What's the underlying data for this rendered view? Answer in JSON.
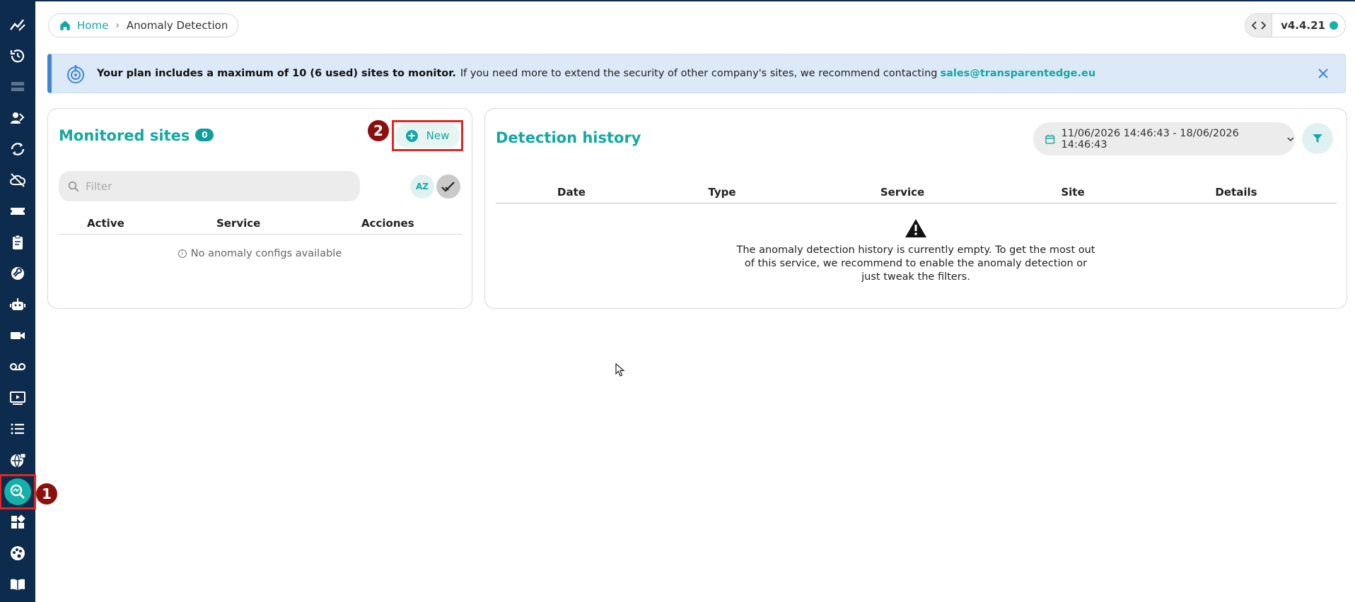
{
  "sidebar": {
    "icons": [
      "analytics-icon",
      "history-icon",
      "servers-icon",
      "users-icon",
      "sync-icon",
      "cloud-off-icon",
      "ticket-icon",
      "clipboard-icon",
      "wrench-icon",
      "robot-icon",
      "video-icon",
      "voicemail-icon",
      "player-icon",
      "list-icon",
      "globe-lock-icon",
      "anomaly-detection-icon",
      "dashboard-icon",
      "palette-icon",
      "book-icon"
    ],
    "active": "anomaly-detection-icon"
  },
  "steps": {
    "one": "1",
    "two": "2"
  },
  "breadcrumb": {
    "home": "Home",
    "separator": "›",
    "current": "Anomaly Detection"
  },
  "version": {
    "label": "v4.4.21"
  },
  "alert": {
    "bold": "Your plan includes a maximum of 10 (6 used) sites to monitor.",
    "text": "If you need more to extend the security of other company's sites, we recommend contacting",
    "email": "sales@transparentedge.eu"
  },
  "monitored": {
    "title": "Monitored sites",
    "count": "0",
    "new_label": "New",
    "filter_placeholder": "Filter",
    "sort_label": "AZ",
    "columns": [
      "Active",
      "Service",
      "Acciones"
    ],
    "empty": "No anomaly configs available"
  },
  "history": {
    "title": "Detection history",
    "date_range": "11/06/2026 14:46:43 - 18/06/2026 14:46:43",
    "columns": [
      "Date",
      "Type",
      "Service",
      "Site",
      "Details"
    ],
    "empty": "The anomaly detection history is currently empty. To get the most out of this service, we recommend to enable the anomaly detection or just tweak the filters."
  },
  "colors": {
    "sidebar": "#0d2b4c",
    "accent": "#14a8a2",
    "alert_bg": "#dce9f8",
    "step": "#8b0f0f",
    "highlight": "#e0261f"
  }
}
